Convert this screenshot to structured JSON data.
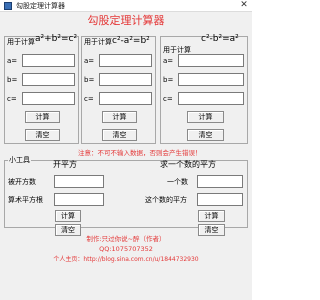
{
  "window": {
    "title": "勾股定理计算器",
    "close_glyph": "✕"
  },
  "header": {
    "title": "勾股定理计算器"
  },
  "panels": [
    {
      "prefix": "用于计算",
      "formula": "a²+b²=c²",
      "labels": [
        "a=",
        "b=",
        "c="
      ],
      "values": [
        "",
        "",
        ""
      ],
      "calc_label": "计算",
      "clear_label": "清空"
    },
    {
      "prefix": "用于计算",
      "formula": "c²-a²=b²",
      "labels": [
        "a=",
        "b=",
        "c="
      ],
      "values": [
        "",
        "",
        ""
      ],
      "calc_label": "计算",
      "clear_label": "清空"
    },
    {
      "prefix": "用于计算",
      "formula": "c²-b²=a²",
      "labels": [
        "a=",
        "b=",
        "c="
      ],
      "values": [
        "",
        "",
        ""
      ],
      "calc_label": "计算",
      "clear_label": "清空"
    }
  ],
  "notice": "注意：不可不输入数据，否则会产生错误！",
  "tools": {
    "group_label": "小工具",
    "sqrt": {
      "title": "开平方",
      "input_label": "被开方数",
      "result_label": "算术平方根",
      "calc_label": "计算",
      "clear_label": "清空"
    },
    "square": {
      "title": "求一个数的平方",
      "input_label": "一个数",
      "result_label": "这个数的平方",
      "calc_label": "计算",
      "clear_label": "清空"
    }
  },
  "footer": {
    "author": "制作:只过你说~醉（作者）",
    "qq": "QQ:1075707352",
    "homepage": "个人主页：http://blog.sina.com.cn/u/1844732930"
  },
  "colors": {
    "accent": "#e43838",
    "background": "#f0f0f0"
  }
}
